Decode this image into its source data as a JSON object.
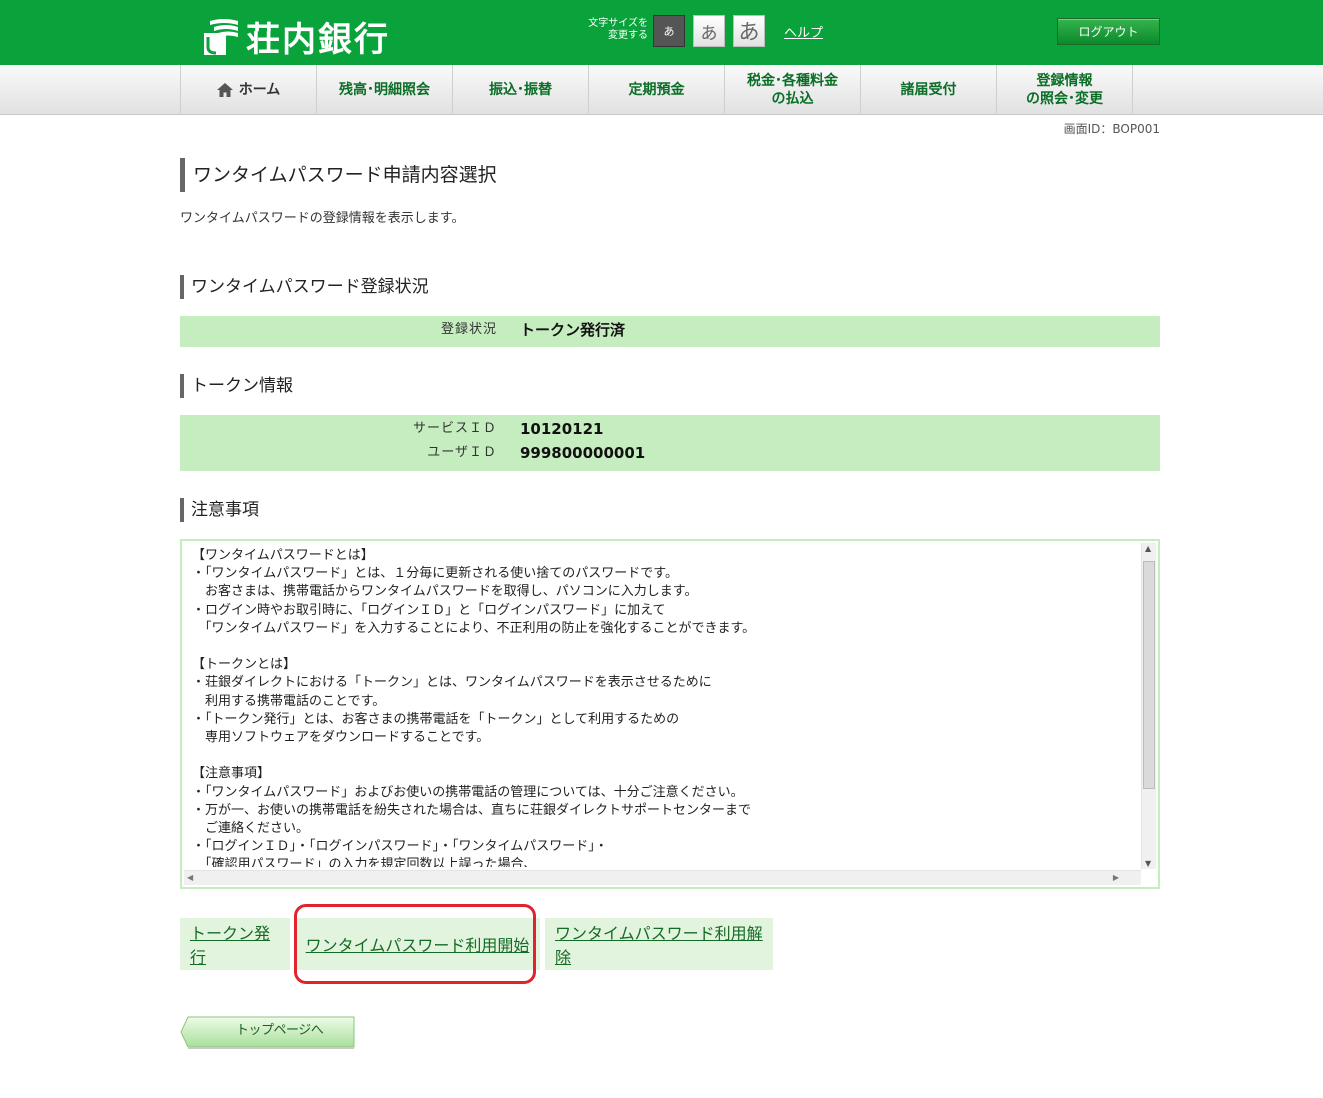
{
  "header": {
    "bank_name": "荘内銀行",
    "font_size_label": "文字サイズを\n変更する",
    "font_size_buttons": [
      "あ",
      "あ",
      "あ"
    ],
    "help_label": "ヘルプ",
    "logout_label": "ログアウト"
  },
  "nav": {
    "items": [
      {
        "label": "ホーム"
      },
      {
        "label": "残高･明細照会"
      },
      {
        "label": "振込･振替"
      },
      {
        "label": "定期預金"
      },
      {
        "label": "税金･各種料金\nの払込"
      },
      {
        "label": "諸届受付"
      },
      {
        "label": "登録情報\nの照会･変更"
      }
    ]
  },
  "screen_id": "画面ID：BOP001",
  "page": {
    "title": "ワンタイムパスワード申請内容選択",
    "lead": "ワンタイムパスワードの登録情報を表示します。"
  },
  "registration": {
    "heading": "ワンタイムパスワード登録状況",
    "status_label": "登録状況",
    "status_value": "トークン発行済"
  },
  "token": {
    "heading": "トークン情報",
    "service_id_label": "サービスＩＤ",
    "service_id_value": "10120121",
    "user_id_label": "ユーザＩＤ",
    "user_id_value": "999800000001"
  },
  "notice": {
    "heading": "注意事項",
    "text": "【ワンタイムパスワードとは】\n・「ワンタイムパスワード」とは、１分毎に更新される使い捨てのパスワードです。\n　お客さまは、携帯電話からワンタイムパスワードを取得し、パソコンに入力します。\n・ログイン時やお取引時に、「ログインＩＤ」と「ログインパスワード」に加えて\n　「ワンタイムパスワード」を入力することにより、不正利用の防止を強化することができます。\n\n【トークンとは】\n・荘銀ダイレクトにおける「トークン」とは、ワンタイムパスワードを表示させるために\n　利用する携帯電話のことです。\n・「トークン発行」とは、お客さまの携帯電話を「トークン」として利用するための\n　専用ソフトウェアをダウンロードすることです。\n\n【注意事項】\n・「ワンタイムパスワード」およびお使いの携帯電話の管理については、十分ご注意ください。\n・万が一、お使いの携帯電話を紛失された場合は、直ちに荘銀ダイレクトサポートセンターまで\n　ご連絡ください。\n・「ログインＩＤ」・「ログインパスワード」・「ワンタイムパスワード」・\n　「確認用パスワード」の入力を規定回数以上誤った場合、"
  },
  "actions": {
    "issue_token": "トークン発行",
    "start_otp": "ワンタイムパスワード利用開始",
    "cancel_otp": "ワンタイムパスワード利用解除"
  },
  "top_page_label": "トップページへ",
  "colors": {
    "brand_green": "#0aa23a",
    "panel_green": "#c6edc0",
    "link_green": "#146b25",
    "highlight_red": "#e0232c"
  }
}
